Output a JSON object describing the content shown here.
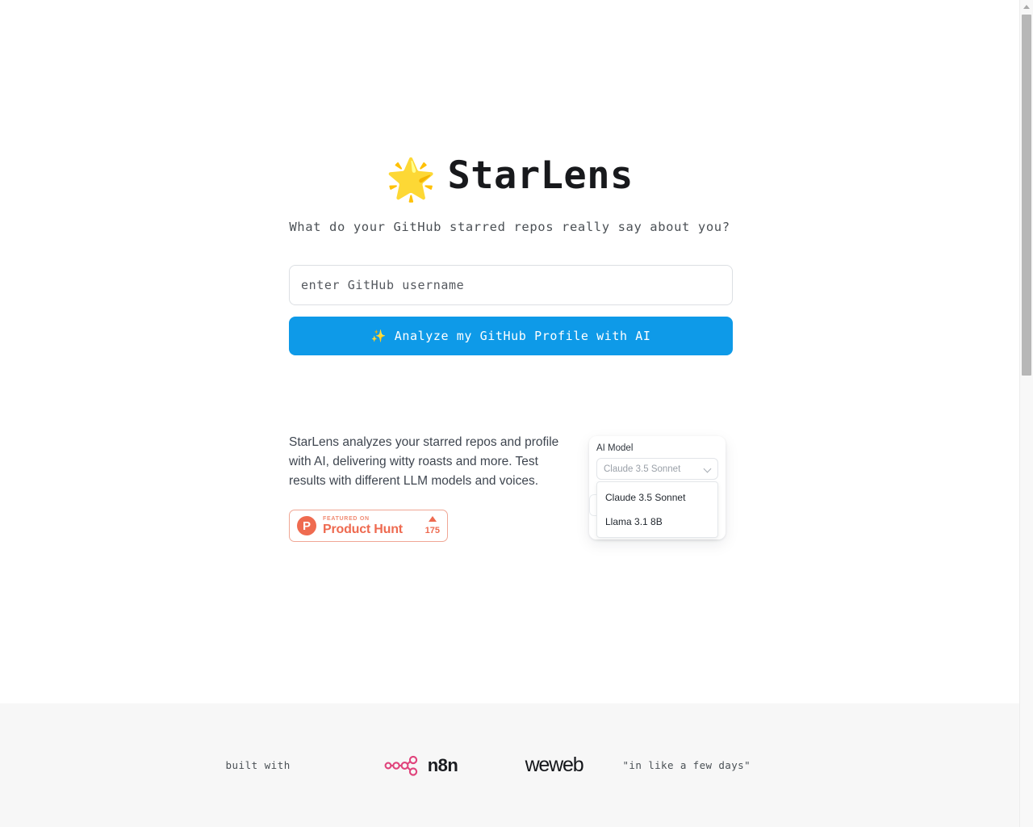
{
  "hero": {
    "star_emoji": "🌟",
    "title": "StarLens",
    "subtitle": "What do your GitHub starred repos really say about you?",
    "username_placeholder": "enter GitHub username",
    "username_value": "",
    "analyze_sparkle": "✨",
    "analyze_label": "Analyze my GitHub Profile with AI"
  },
  "info": {
    "description": "StarLens analyzes your starred repos and profile with AI, delivering witty roasts and more. Test results with different LLM models and voices.",
    "product_hunt": {
      "logo_letter": "P",
      "featured_on": "FEATURED ON",
      "name": "Product Hunt",
      "votes": "175"
    }
  },
  "model_card": {
    "label": "AI Model",
    "selected_value": "Claude 3.5 Sonnet",
    "options": [
      {
        "label": "Claude 3.5 Sonnet"
      },
      {
        "label": "Llama 3.1 8B"
      }
    ],
    "hidden_chevron": "v"
  },
  "footer": {
    "built_with": "built with",
    "n8n_label": "n8n",
    "weweb_label": "weweb",
    "quote": "\"in like a few days\""
  },
  "colors": {
    "accent_blue": "#0e9ae8",
    "product_hunt": "#ee6a50",
    "n8n_pink": "#e0447c",
    "footer_bg": "#f7f7f7"
  }
}
